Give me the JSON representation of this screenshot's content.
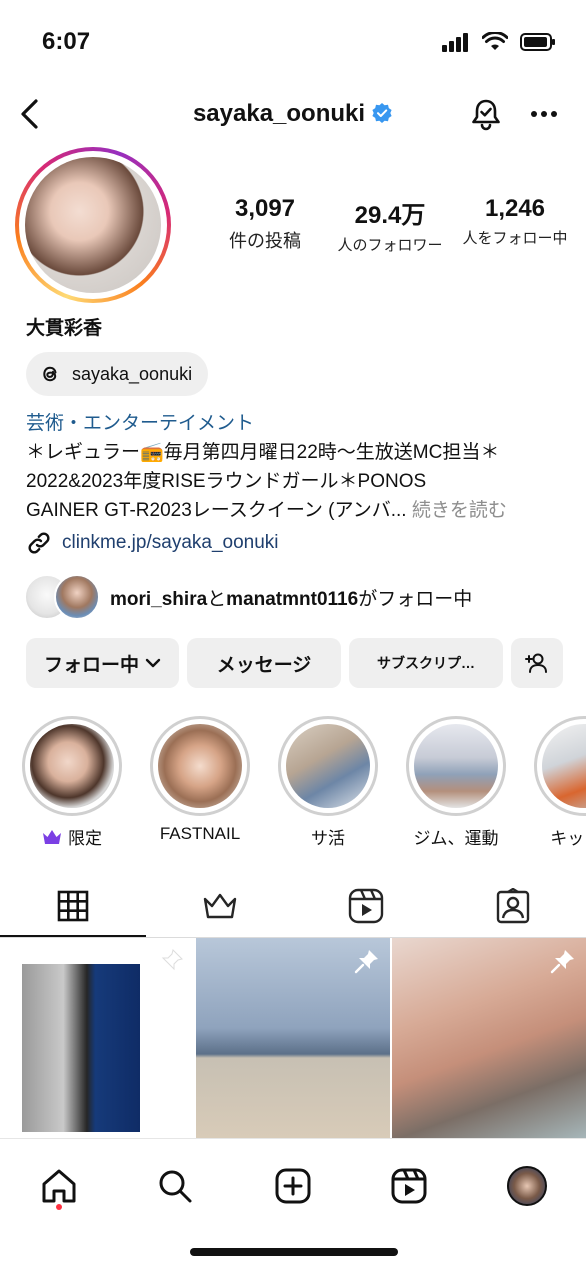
{
  "status": {
    "time": "6:07"
  },
  "header": {
    "username": "sayaka_oonuki"
  },
  "profile": {
    "stats": [
      {
        "value": "3,097",
        "label": "件の投稿"
      },
      {
        "value": "29.4万",
        "label": "人のフォロワー"
      },
      {
        "value": "1,246",
        "label": "人をフォロー中"
      }
    ],
    "display_name": "大貫彩香",
    "threads_handle": "sayaka_oonuki",
    "category": "芸術・エンターテイメント",
    "bio": {
      "line1": "＊レギュラー📻毎月第四月曜日22時〜生放送MC担当＊",
      "line2": "2022&2023年度RISEラウンドガール＊PONOS",
      "line3": "GAINER GT-R2023レースクイーン (アンバ...",
      "more": "続きを読む"
    },
    "link": "clinkme.jp/sayaka_oonuki",
    "followed_by": {
      "user1": "mori_shira",
      "and": "と",
      "user2": "manatmnt0116",
      "suffix": "がフォロー中"
    }
  },
  "actions": {
    "follow_label": "フォロー中",
    "message_label": "メッセージ",
    "subscribe_label": "サブスクリプ…"
  },
  "highlights": [
    {
      "label": "限定",
      "icon": "crown-icon",
      "color": "#7b3fe4"
    },
    {
      "label": "FASTNAIL"
    },
    {
      "label": "サ活"
    },
    {
      "label": "ジム、運動"
    },
    {
      "label": "キックス"
    }
  ],
  "tabs": [
    "grid-icon",
    "crown-icon",
    "reels-icon",
    "tagged-icon"
  ],
  "colors": {
    "link": "#1f3f6e",
    "category": "#1f5b8e",
    "verified": "#3897f0",
    "notification_dot": "#ff3040"
  }
}
